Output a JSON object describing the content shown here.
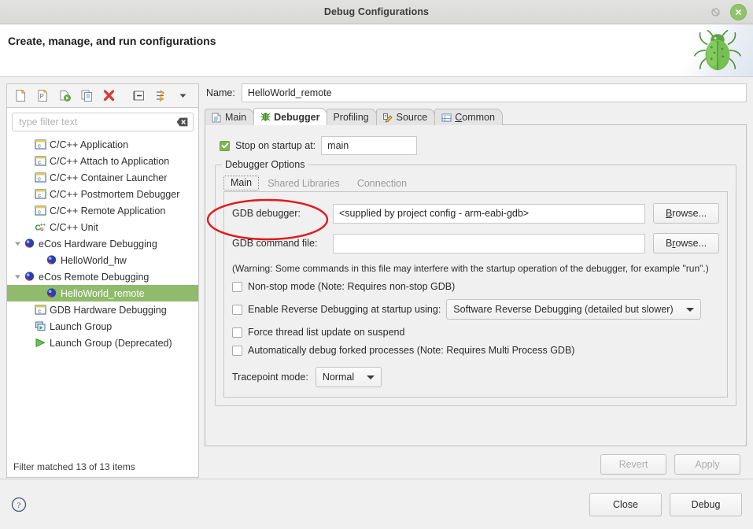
{
  "window": {
    "title": "Debug Configurations",
    "restore_icon": "restore-icon",
    "close_icon": "close-icon"
  },
  "header": {
    "title": "Create, manage, and run configurations",
    "art_icon": "bug-icon"
  },
  "toolbar": {
    "buttons": [
      {
        "name": "new-configuration-button",
        "icon": "new-document-icon"
      },
      {
        "name": "new-prototype-button",
        "icon": "new-prototype-icon"
      },
      {
        "name": "export-button",
        "icon": "export-run-icon"
      },
      {
        "name": "duplicate-button",
        "icon": "duplicate-icon"
      },
      {
        "name": "delete-button",
        "icon": "delete-x-icon"
      },
      {
        "name": "collapse-all-button",
        "icon": "collapse-all-icon"
      },
      {
        "name": "filter-button",
        "icon": "filter-arrows-icon"
      },
      {
        "name": "view-menu-button",
        "icon": "chevron-down-icon"
      }
    ]
  },
  "filter": {
    "placeholder": "type filter text",
    "value": "",
    "clear_icon": "clear-icon",
    "status": "Filter matched 13 of 13 items"
  },
  "tree": {
    "items": [
      {
        "label": "C/C++ Application",
        "icon": "c-launch-icon",
        "indent": 1,
        "twisty": "none",
        "selected": false
      },
      {
        "label": "C/C++ Attach to Application",
        "icon": "c-launch-icon",
        "indent": 1,
        "twisty": "none",
        "selected": false
      },
      {
        "label": "C/C++ Container Launcher",
        "icon": "c-launch-icon",
        "indent": 1,
        "twisty": "none",
        "selected": false
      },
      {
        "label": "C/C++ Postmortem Debugger",
        "icon": "c-launch-icon",
        "indent": 1,
        "twisty": "none",
        "selected": false
      },
      {
        "label": "C/C++ Remote Application",
        "icon": "c-launch-icon",
        "indent": 1,
        "twisty": "none",
        "selected": false
      },
      {
        "label": "C/C++ Unit",
        "icon": "cppunit-icon",
        "indent": 1,
        "twisty": "none",
        "selected": false
      },
      {
        "label": "eCos Hardware Debugging",
        "icon": "ecos-sphere-icon",
        "indent": 0,
        "twisty": "expanded",
        "selected": false
      },
      {
        "label": "HelloWorld_hw",
        "icon": "ecos-sphere-icon",
        "indent": 2,
        "twisty": "none",
        "selected": false
      },
      {
        "label": "eCos Remote Debugging",
        "icon": "ecos-sphere-icon",
        "indent": 0,
        "twisty": "expanded",
        "selected": false
      },
      {
        "label": "HelloWorld_remote",
        "icon": "ecos-sphere-icon",
        "indent": 2,
        "twisty": "none",
        "selected": true
      },
      {
        "label": "GDB Hardware Debugging",
        "icon": "c-launch-icon",
        "indent": 1,
        "twisty": "none",
        "selected": false
      },
      {
        "label": "Launch Group",
        "icon": "launch-group-icon",
        "indent": 1,
        "twisty": "none",
        "selected": false
      },
      {
        "label": "Launch Group (Deprecated)",
        "icon": "launch-group-deprecated-icon",
        "indent": 1,
        "twisty": "none",
        "selected": false
      }
    ]
  },
  "config": {
    "name_label": "Name:",
    "name_value": "HelloWorld_remote"
  },
  "tabs": [
    {
      "label": "Main",
      "icon": "document-icon",
      "active": false,
      "mnemonic": ""
    },
    {
      "label": "Debugger",
      "icon": "debugger-bug-icon",
      "active": true,
      "mnemonic": ""
    },
    {
      "label": "Profiling",
      "icon": "none",
      "active": false,
      "mnemonic": ""
    },
    {
      "label": "Source",
      "icon": "source-pencil-icon",
      "active": false,
      "mnemonic": ""
    },
    {
      "label": "Common",
      "icon": "common-table-icon",
      "active": false,
      "mnemonic": "C"
    }
  ],
  "debugger_tab": {
    "stop_on_startup": {
      "label": "Stop on startup at:",
      "checked": true,
      "value": "main"
    },
    "group_title": "Debugger Options",
    "inner_tabs": [
      {
        "label": "Main",
        "active": true
      },
      {
        "label": "Shared Libraries",
        "active": false
      },
      {
        "label": "Connection",
        "active": false
      }
    ],
    "gdb_debugger": {
      "label": "GDB debugger:",
      "value": "<supplied by project config - arm-eabi-gdb>",
      "browse_label": "Browse...",
      "browse_mnemonic": "B"
    },
    "gdb_command_file": {
      "label": "GDB command file:",
      "value": "",
      "browse_label": "Browse...",
      "browse_mnemonic": "r",
      "annotated": true,
      "annotation_color": "#e01b1b"
    },
    "warning": "(Warning: Some commands in this file may interfere with the startup operation of the debugger, for example \"run\".)",
    "checkboxes": [
      {
        "label": "Non-stop mode (Note: Requires non-stop GDB)",
        "checked": false,
        "name": "non-stop-mode-checkbox"
      },
      {
        "label": "Enable Reverse Debugging at startup using:",
        "checked": false,
        "name": "reverse-debugging-checkbox"
      },
      {
        "label": "Force thread list update on suspend",
        "checked": false,
        "name": "force-thread-list-update-checkbox"
      },
      {
        "label": "Automatically debug forked processes (Note: Requires Multi Process GDB)",
        "checked": false,
        "name": "auto-debug-forked-checkbox"
      }
    ],
    "reverse_debugging_combo": {
      "value": "Software Reverse Debugging (detailed but slower)"
    },
    "tracepoint_mode": {
      "label": "Tracepoint mode:",
      "value": "Normal"
    }
  },
  "actions": {
    "revert": "Revert",
    "revert_enabled": false,
    "apply": "Apply",
    "apply_enabled": false
  },
  "footer": {
    "help_icon": "help-question-icon",
    "close": "Close",
    "debug": "Debug"
  },
  "colors": {
    "selection_green": "#90ba6c",
    "annotation_red": "#e01b1b",
    "panel_bg": "#f0f0f0",
    "white": "#ffffff"
  }
}
